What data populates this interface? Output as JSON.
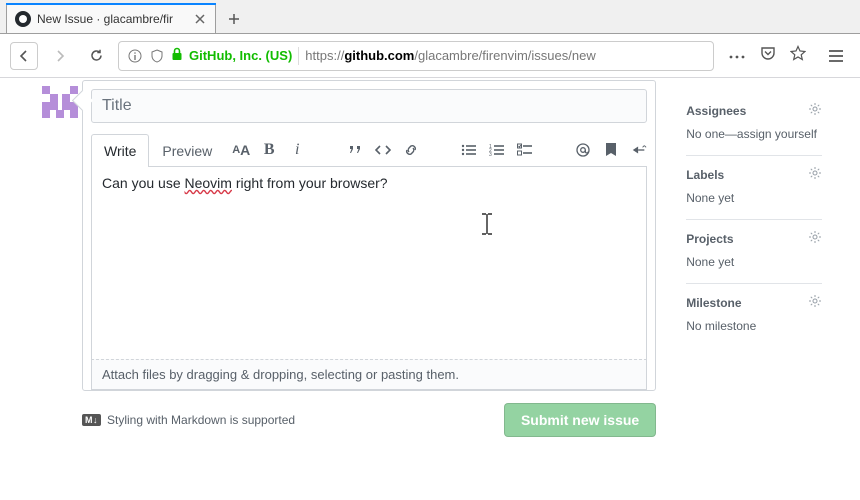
{
  "browser": {
    "tab_title": "New Issue · glacambre/fir",
    "identity": "GitHub, Inc. (US)",
    "url_prefix": "https://",
    "url_host": "github.com",
    "url_path": "/glacambre/firenvim/issues/new"
  },
  "issue": {
    "title_placeholder": "Title",
    "title_value": "",
    "tabs": {
      "write": "Write",
      "preview": "Preview"
    },
    "body_before": "Can you use ",
    "body_misspelled": "Neovim",
    "body_after": " right from your browser?",
    "attach_hint": "Attach files by dragging & dropping, selecting or pasting them.",
    "markdown_hint": "Styling with Markdown is supported",
    "markdown_badge": "M↓",
    "submit_label": "Submit new issue"
  },
  "sidebar": {
    "assignees": {
      "title": "Assignees",
      "body": "No one—assign yourself"
    },
    "labels": {
      "title": "Labels",
      "body": "None yet"
    },
    "projects": {
      "title": "Projects",
      "body": "None yet"
    },
    "milestone": {
      "title": "Milestone",
      "body": "No milestone"
    }
  }
}
